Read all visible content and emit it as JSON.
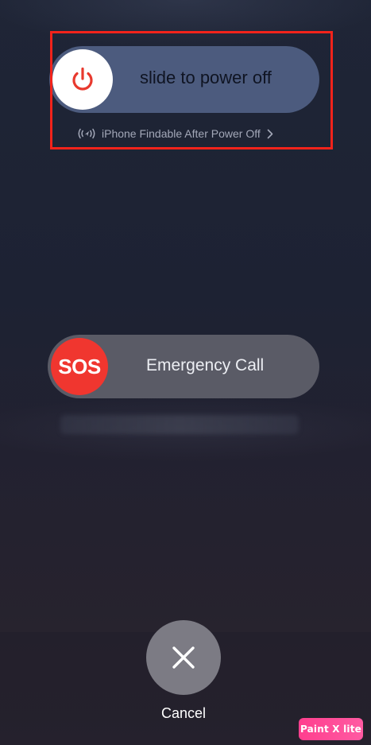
{
  "power_off": {
    "slider_label": "slide to power off",
    "findable_text": "iPhone Findable After Power Off",
    "icons": {
      "knob": "power-icon",
      "findable": "find-my-signal-icon",
      "chevron": "chevron-right-icon"
    },
    "colors": {
      "track": "#4c5b7e",
      "knob": "#ffffff",
      "icon": "#e8392e",
      "highlight": "#f2231b"
    }
  },
  "emergency": {
    "knob_label": "SOS",
    "slider_label": "Emergency Call",
    "colors": {
      "track": "#5a5b66",
      "knob": "#f0362f"
    }
  },
  "cancel": {
    "label": "Cancel",
    "icon": "close-icon"
  },
  "watermark": {
    "text": "Paint X lite"
  }
}
